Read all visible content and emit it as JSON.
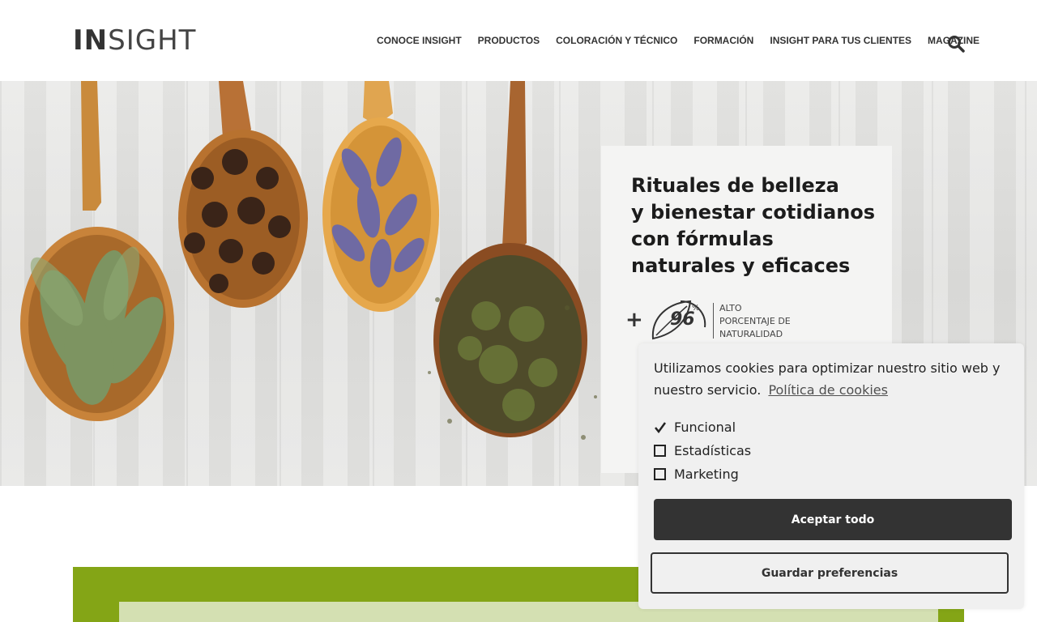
{
  "header": {
    "logo_bold": "IN",
    "logo_light": "SIGHT",
    "nav": [
      "CONOCE INSIGHT",
      "PRODUCTOS",
      "COLORACIÓN Y TÉCNICO",
      "FORMACIÓN",
      "INSIGHT PARA TUS CLIENTES",
      "MAGAZINE"
    ],
    "search_icon": "search-icon"
  },
  "hero": {
    "title_lines": [
      "Rituales de belleza",
      "y bienestar cotidianos",
      "con fórmulas",
      "naturales y eficaces"
    ],
    "badge": {
      "plus": "+",
      "number": "96",
      "percent": "%",
      "text_lines": [
        "ALTO",
        "PORCENTAJE DE",
        "NATURALIDAD"
      ]
    },
    "next_icon": "chevron-right-icon"
  },
  "cookie": {
    "message": "Utilizamos cookies para optimizar nuestro sitio web y nuestro servicio.",
    "policy_link": "Política de cookies",
    "options": [
      {
        "label": "Funcional",
        "checked": true
      },
      {
        "label": "Estadísticas",
        "checked": false
      },
      {
        "label": "Marketing",
        "checked": false
      }
    ],
    "accept_label": "Aceptar todo",
    "save_label": "Guardar preferencias"
  },
  "colors": {
    "accent_green": "#84a516",
    "light_green": "#d4e0b2",
    "dark_button": "#333333"
  }
}
